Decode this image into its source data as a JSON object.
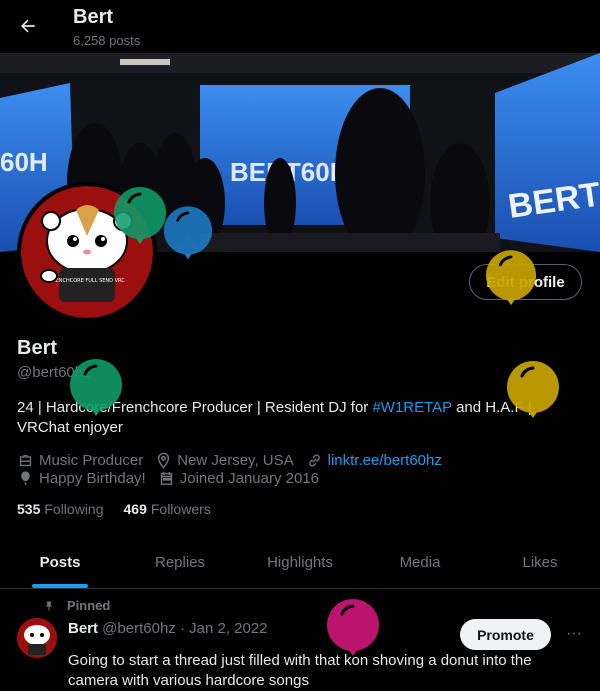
{
  "header": {
    "title": "Bert",
    "post_count": "6,258 posts"
  },
  "banner": {
    "screen_text_1": "BERT60HZ",
    "screen_text_2": "BERT6",
    "screen_text_3": "60H"
  },
  "avatar_shirt_text": "FRENCHCORE\nFULL SEND VRC",
  "profile": {
    "edit_label": "Edit profile",
    "name": "Bert",
    "handle": "@bert60hz",
    "bio_prefix": "24 | Hardcore/Frenchcore Producer | Resident DJ for ",
    "bio_hashtag": "#W1RETAP",
    "bio_suffix": " and H.A.F | VRChat enjoyer",
    "occupation": "Music Producer",
    "location": "New Jersey, USA",
    "website": "linktr.ee/bert60hz",
    "birthday": "Happy Birthday!",
    "joined": "Joined January 2016",
    "following_count": "535",
    "following_label": "Following",
    "followers_count": "469",
    "followers_label": "Followers"
  },
  "tabs": [
    {
      "label": "Posts",
      "active": true
    },
    {
      "label": "Replies",
      "active": false
    },
    {
      "label": "Highlights",
      "active": false
    },
    {
      "label": "Media",
      "active": false
    },
    {
      "label": "Likes",
      "active": false
    }
  ],
  "post": {
    "pinned_label": "Pinned",
    "author": "Bert",
    "meta": " @bert60hz · Jan 2, 2022",
    "promote_label": "Promote",
    "more_glyph": "···",
    "text": "Going to start a thread just filled with that kon shoving a donut into the camera with various hardcore songs"
  },
  "colors": {
    "background": "#000000",
    "accent": "#1d9bf0",
    "muted": "#71767b",
    "balloon_green": "#109b6a",
    "balloon_blue": "#1c7cc7",
    "balloon_gold": "#c9a400",
    "balloon_pink": "#c51574"
  },
  "icons": [
    "back-arrow-icon",
    "briefcase-icon",
    "location-pin-icon",
    "link-icon",
    "balloon-icon",
    "calendar-icon",
    "pin-icon",
    "more-icon"
  ]
}
